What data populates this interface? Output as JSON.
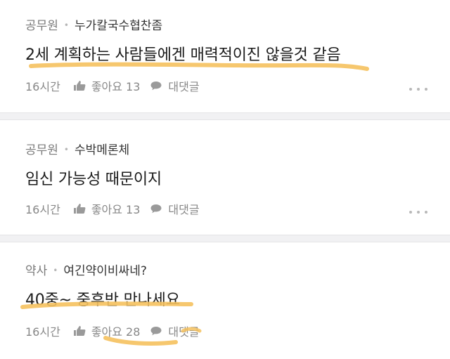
{
  "comments": [
    {
      "badge": "공무원",
      "nickname": "누가칼국수협찬좀",
      "text": "2세 계획하는 사람들에겐 매력적이진 않을것 같음",
      "time": "16시간",
      "like_label": "좋아요 13",
      "reply_label": "대댓글"
    },
    {
      "badge": "공무원",
      "nickname": "수박메론체",
      "text": "임신 가능성 때문이지",
      "time": "16시간",
      "like_label": "좋아요 13",
      "reply_label": "대댓글"
    },
    {
      "badge": "약사",
      "nickname": "여긴약이비싸네?",
      "text": "40중~ 중후반 만나세요",
      "time": "16시간",
      "like_label": "좋아요 28",
      "reply_label": "대댓글"
    }
  ],
  "colors": {
    "highlight": "#f5c15e",
    "meta": "#7a7a7a",
    "text": "#1b1b1b",
    "divider": "#f1f1f3"
  }
}
